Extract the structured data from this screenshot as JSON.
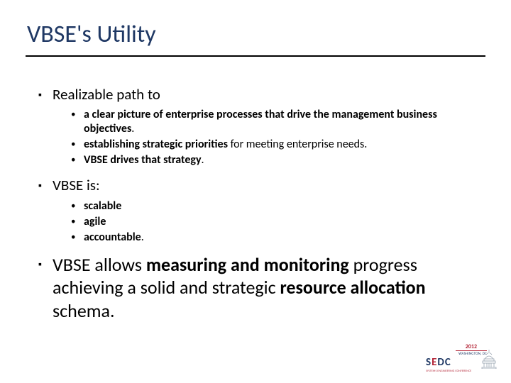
{
  "title": "VBSE's Utility",
  "bullets": {
    "b1": "Realizable path to",
    "b1s": [
      {
        "bold": "a clear picture of enterprise processes that drive the management business objectives",
        "tail": "."
      },
      {
        "bold": "establishing strategic priorities ",
        "tail": "for meeting enterprise needs."
      },
      {
        "bold": "VBSE drives that strategy",
        "tail": "."
      }
    ],
    "b2": "VBSE is:",
    "b2s": [
      {
        "bold": "scalable",
        "tail": ""
      },
      {
        "bold": "agile",
        "tail": ""
      },
      {
        "bold": "accountable",
        "tail": "."
      }
    ],
    "b3_lead": "VBSE allows ",
    "b3_bold1": "measuring and monitoring",
    "b3_mid": " progress achieving a solid and strategic ",
    "b3_bold2": "resource allocation ",
    "b3_tail": "schema."
  },
  "logo": {
    "year": "2012",
    "sub": "WASHINGTON, DC",
    "s": "S",
    "e": "E",
    "d": "D",
    "c": "C",
    "tag": "SYSTEMS ENGINEERING CONFERENCE"
  }
}
